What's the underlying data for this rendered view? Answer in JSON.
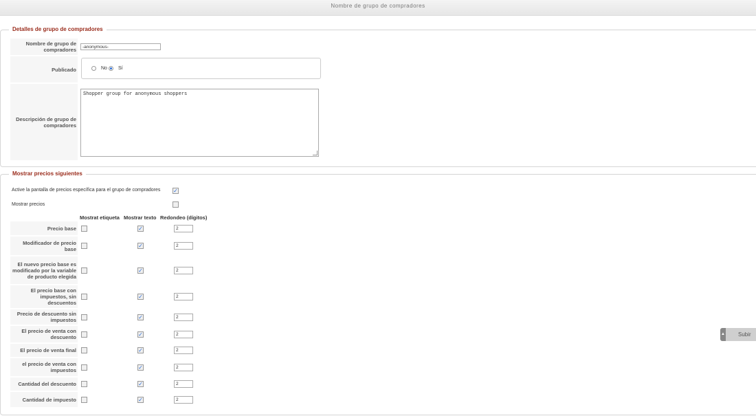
{
  "header": {
    "title": "Nombre de grupo de compradores"
  },
  "details": {
    "legend": "Detalles de grupo de compradores",
    "name_label": "Nombre de grupo de compradores",
    "name_value": "-anonymous-",
    "published_label": "Publicado",
    "published_options": [
      "No",
      "Sí"
    ],
    "published_selected": "Sí",
    "description_label": "Descripción de grupo de compradores",
    "description_value": "Shopper group for anonymous shoppers"
  },
  "prices": {
    "legend": "Mostrar precios siguientes",
    "activate_label": "Active la pantalla de precios específica para el grupo de compradores",
    "activate_checked": true,
    "show_prices_label": "Mostrar precios",
    "show_prices_checked": false,
    "columns": [
      "Mostrat etiqueta",
      "Mostrar texto",
      "Redondeo (dígitos)"
    ],
    "rows": [
      {
        "label": "Precio base",
        "show_label": false,
        "show_text": true,
        "rounding": "2"
      },
      {
        "label": "Modificador de precio base",
        "show_label": false,
        "show_text": true,
        "rounding": "2"
      },
      {
        "label": "El nuevo precio base es modificado por la variable de producto elegida",
        "show_label": false,
        "show_text": true,
        "rounding": "2"
      },
      {
        "label": "El precio base con impuestos, sin descuentos",
        "show_label": false,
        "show_text": true,
        "rounding": "2"
      },
      {
        "label": "Precio de descuento sin impuestos",
        "show_label": false,
        "show_text": true,
        "rounding": "2"
      },
      {
        "label": "El precio de venta con descuento",
        "show_label": false,
        "show_text": true,
        "rounding": "2"
      },
      {
        "label": "El precio de venta final",
        "show_label": false,
        "show_text": true,
        "rounding": "2"
      },
      {
        "label": "el precio de venta con impuestos",
        "show_label": false,
        "show_text": true,
        "rounding": "2"
      },
      {
        "label": "Cantidad del descuento",
        "show_label": false,
        "show_text": true,
        "rounding": "2"
      },
      {
        "label": "Cantidad de impuesto",
        "show_label": false,
        "show_text": true,
        "rounding": "2"
      }
    ]
  },
  "scroll_top": {
    "label": "Subir"
  },
  "colors": {
    "legend": "#9a2c1c",
    "accent": "#2a6bd3"
  }
}
